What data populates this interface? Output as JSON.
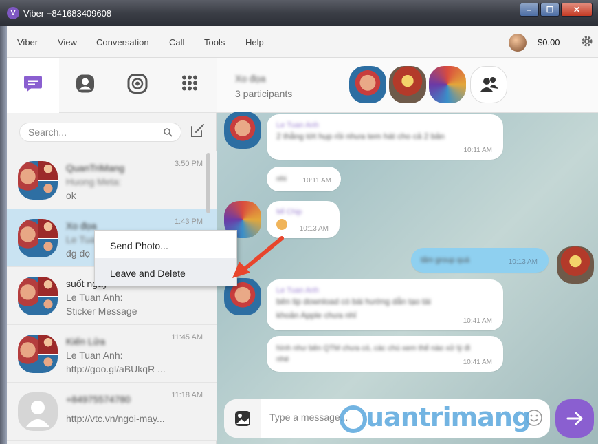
{
  "window": {
    "title": "Viber +841683409608",
    "controls": [
      "–",
      "☐",
      "✕"
    ]
  },
  "menu": {
    "items": [
      "Viber",
      "View",
      "Conversation",
      "Call",
      "Tools",
      "Help"
    ],
    "credit": "$0.00"
  },
  "sidebar": {
    "search_placeholder": "Search...",
    "conversations": [
      {
        "name": "QuanTriMang",
        "sender": "Huong Meta:",
        "preview": "ok",
        "time": "3:50 PM"
      },
      {
        "name": "Xo đọa",
        "sender": "Le Tuan Anh:",
        "preview": "đg đọ",
        "time": "1:43 PM"
      },
      {
        "name": "suốt ngày",
        "sender": "Le Tuan Anh:",
        "preview": "Sticker Message",
        "time": ""
      },
      {
        "name": "Kiến Lửa",
        "sender": "Le Tuan Anh:",
        "preview": "http://goo.gl/aBUkqR ...",
        "time": "11:45 AM"
      },
      {
        "name": "+84975574780",
        "sender": "",
        "preview": "http://vtc.vn/ngoi-may...",
        "time": "11:18 AM"
      }
    ]
  },
  "context_menu": {
    "items": [
      "Send Photo...",
      "Leave and Delete"
    ]
  },
  "chat": {
    "title": "Xo đọa",
    "participants": "3 participants",
    "messages": [
      {
        "sender": "Le Tuan Anh",
        "text": "2 thằng tớt hụp rồi nhưa tem hát cho cả 2 bản",
        "time": "10:11 AM"
      },
      {
        "sender": "",
        "text": "nhi",
        "time": "10:11 AM"
      },
      {
        "sender": "Mỉ Chịp",
        "text": "",
        "time": "10:13 AM"
      },
      {
        "sender": "",
        "text": "tấm group quá",
        "time": "10:13 AM"
      },
      {
        "sender": "Le Tuan Anh",
        "text": "bên tip download có bài hướng dẫn tạo tài khoản Apple chưa nhỉ",
        "time": "10:41 AM"
      },
      {
        "sender": "",
        "text": "hình như bên QTM chưa có, các chú xem thế nào xử lý đi nhé",
        "time": "10:41 AM"
      }
    ],
    "composer_placeholder": "Type a message..."
  },
  "watermark": "uantrimang"
}
